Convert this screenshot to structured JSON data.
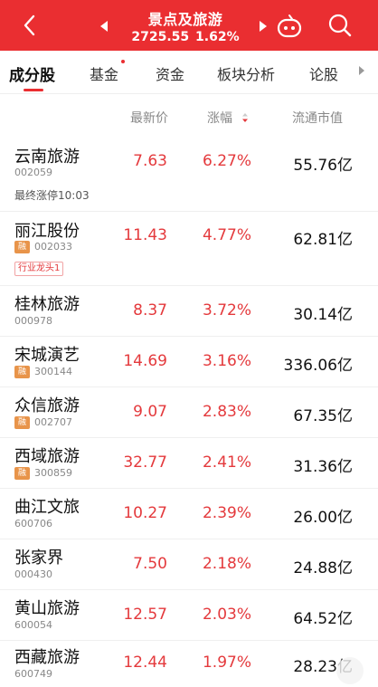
{
  "header": {
    "title": "景点及旅游",
    "index_value": "2725.55",
    "index_change": "1.62%",
    "bg_color": "#ea2e31"
  },
  "tabs": [
    {
      "label": "成分股",
      "active": true
    },
    {
      "label": "基金",
      "active": false
    },
    {
      "label": "资金",
      "active": false
    },
    {
      "label": "板块分析",
      "active": false
    },
    {
      "label": "论股",
      "active": false
    }
  ],
  "columns": {
    "price": "最新价",
    "change": "涨幅",
    "mcap": "流通市值"
  },
  "rows": [
    {
      "name": "云南旅游",
      "code": "002059",
      "rong": "",
      "price": "7.63",
      "change": "6.27%",
      "mcap": "55.76亿",
      "note": "最终涨停10:03",
      "tag": ""
    },
    {
      "name": "丽江股份",
      "code": "002033",
      "rong": "融",
      "price": "11.43",
      "change": "4.77%",
      "mcap": "62.81亿",
      "note": "",
      "tag": "行业龙头1"
    },
    {
      "name": "桂林旅游",
      "code": "000978",
      "rong": "",
      "price": "8.37",
      "change": "3.72%",
      "mcap": "30.14亿",
      "note": "",
      "tag": ""
    },
    {
      "name": "宋城演艺",
      "code": "300144",
      "rong": "融",
      "price": "14.69",
      "change": "3.16%",
      "mcap": "336.06亿",
      "note": "",
      "tag": ""
    },
    {
      "name": "众信旅游",
      "code": "002707",
      "rong": "融",
      "price": "9.07",
      "change": "2.83%",
      "mcap": "67.35亿",
      "note": "",
      "tag": ""
    },
    {
      "name": "西域旅游",
      "code": "300859",
      "rong": "融",
      "price": "32.77",
      "change": "2.41%",
      "mcap": "31.36亿",
      "note": "",
      "tag": ""
    },
    {
      "name": "曲江文旅",
      "code": "600706",
      "rong": "",
      "price": "10.27",
      "change": "2.39%",
      "mcap": "26.00亿",
      "note": "",
      "tag": ""
    },
    {
      "name": "张家界",
      "code": "000430",
      "rong": "",
      "price": "7.50",
      "change": "2.18%",
      "mcap": "24.88亿",
      "note": "",
      "tag": ""
    },
    {
      "name": "黄山旅游",
      "code": "600054",
      "rong": "",
      "price": "12.57",
      "change": "2.03%",
      "mcap": "64.52亿",
      "note": "",
      "tag": ""
    },
    {
      "name": "西藏旅游",
      "code": "600749",
      "rong": "",
      "price": "12.44",
      "change": "1.97%",
      "mcap": "28.23亿",
      "note": "",
      "tag": ""
    }
  ],
  "icons": {
    "back": "chevron-left-icon",
    "prev": "triangle-left-icon",
    "next": "triangle-right-icon",
    "assistant": "robot-icon",
    "search": "search-icon",
    "sort": "sort-icon"
  },
  "colors": {
    "up": "#e4393c",
    "rong_badge": "#e8944a"
  }
}
